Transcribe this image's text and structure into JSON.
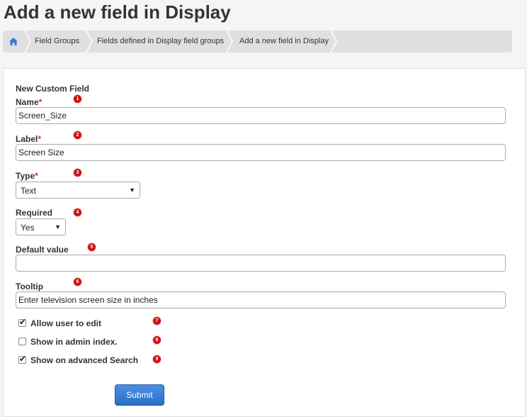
{
  "page": {
    "title": "Add a new field in Display"
  },
  "breadcrumb": {
    "home_icon": "home-icon",
    "items": [
      "Field Groups",
      "Fields defined in Display field groups",
      "Add a new field in Display"
    ]
  },
  "form": {
    "heading": "New Custom Field",
    "name": {
      "label": "Name",
      "required_mark": "*",
      "value": "Screen_Size",
      "badge": "1"
    },
    "label": {
      "label": "Label",
      "required_mark": "*",
      "value": "Screen Size",
      "badge": "2"
    },
    "type": {
      "label": "Type",
      "required_mark": "*",
      "value": "Text",
      "badge": "3"
    },
    "required": {
      "label": "Required",
      "value": "Yes",
      "badge": "4"
    },
    "default_value": {
      "label": "Default value",
      "value": "",
      "badge": "5"
    },
    "tooltip": {
      "label": "Tooltip",
      "value": "Enter television screen size in inches",
      "badge": "6"
    },
    "checkboxes": [
      {
        "label": "Allow user to edit",
        "checked": true,
        "badge": "7"
      },
      {
        "label": "Show in admin index.",
        "checked": false,
        "badge": "8"
      },
      {
        "label": "Show on advanced Search",
        "checked": true,
        "badge": "9"
      }
    ],
    "submit_label": "Submit"
  },
  "colors": {
    "accent": "#2a6fc9",
    "badge": "#cc1111",
    "required": "#c9302c"
  }
}
